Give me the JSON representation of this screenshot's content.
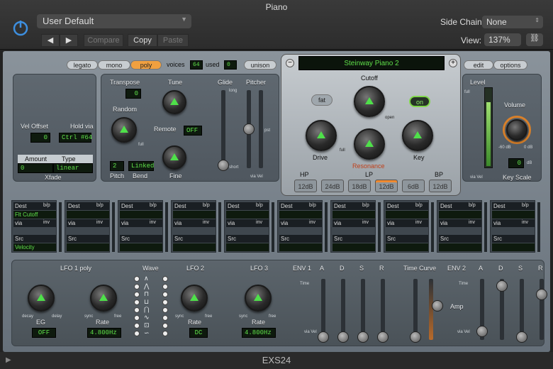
{
  "window": {
    "title": "Piano"
  },
  "header": {
    "preset": "User Default",
    "compare": "Compare",
    "copy": "Copy",
    "paste": "Paste",
    "side_chain_label": "Side Chain:",
    "side_chain_value": "None",
    "view_label": "View:",
    "view_value": "137%"
  },
  "modes": {
    "legato": "legato",
    "mono": "mono",
    "poly": "poly",
    "voices_label": "voices",
    "voices_value": "64",
    "used_label": "used",
    "used_value": "0",
    "unison": "unison"
  },
  "xfade": {
    "vel_offset_label": "Vel Offset",
    "vel_offset_value": "0",
    "hold_via_label": "Hold via",
    "hold_via_value": "Ctrl #64",
    "amount_label": "Amount",
    "type_label": "Type",
    "amount_value": "0",
    "type_value": "linear",
    "title": "Xfade"
  },
  "tune": {
    "transpose_label": "Transpose",
    "transpose_value": "0",
    "tune_label": "Tune",
    "random_label": "Random",
    "remote_label": "Remote",
    "remote_value": "OFF",
    "full": "full",
    "pitch_bend_value": "2",
    "linked": "Linked",
    "pitch_label": "Pitch",
    "bend_label": "Bend",
    "fine_label": "Fine",
    "glide_label": "Glide",
    "pitcher_label": "Pitcher",
    "long": "long",
    "short": "short",
    "via_vel": "via Vel",
    "pst": "pst"
  },
  "instrument": {
    "name": "Steinway Piano 2",
    "edit": "edit",
    "options": "options"
  },
  "filter": {
    "fat": "fat",
    "cutoff": "Cutoff",
    "on": "on",
    "drive": "Drive",
    "key": "Key",
    "resonance": "Resonance",
    "open": "open",
    "full": "full",
    "hp": "HP",
    "lp": "LP",
    "bp": "BP",
    "db_buttons": [
      "12dB",
      "24dB",
      "18dB",
      "12dB",
      "6dB",
      "12dB"
    ]
  },
  "output": {
    "level_label": "Level",
    "full": "full",
    "volume_label": "Volume",
    "minus60": "-60 dB",
    "zero": "0 dB",
    "via_vel": "via Vel",
    "keyscale_label": "Key Scale",
    "keyscale_value": "0",
    "db": "dB"
  },
  "matrix": {
    "dest": "Dest",
    "bp": "b/p",
    "via": "via",
    "inv": "inv",
    "src": "Src",
    "first_dest_value": "Flt Cutoff",
    "first_src_value": "Velocity",
    "slots": 10
  },
  "lfo": {
    "lfo1_title": "LFO 1 poly",
    "wave_label": "Wave",
    "lfo2_title": "LFO 2",
    "lfo3_title": "LFO 3",
    "decay": "decay",
    "delay": "delay",
    "eg_label": "EG",
    "eg_value": "OFF",
    "sync": "sync",
    "free": "free",
    "rate_label": "Rate",
    "lfo1_rate": "4.800Hz",
    "lfo2_rate": "DC",
    "lfo3_rate": "4.800Hz"
  },
  "env": {
    "env1_title": "ENV 1",
    "env2_title": "ENV 2",
    "time_curve": "Time Curve",
    "amp_label": "Amp",
    "a": "A",
    "d": "D",
    "s": "S",
    "r": "R",
    "time": "Time",
    "long": "long",
    "short": "short",
    "full": "full",
    "via_vel": "via Vel"
  },
  "footer": {
    "title": "EXS24"
  }
}
